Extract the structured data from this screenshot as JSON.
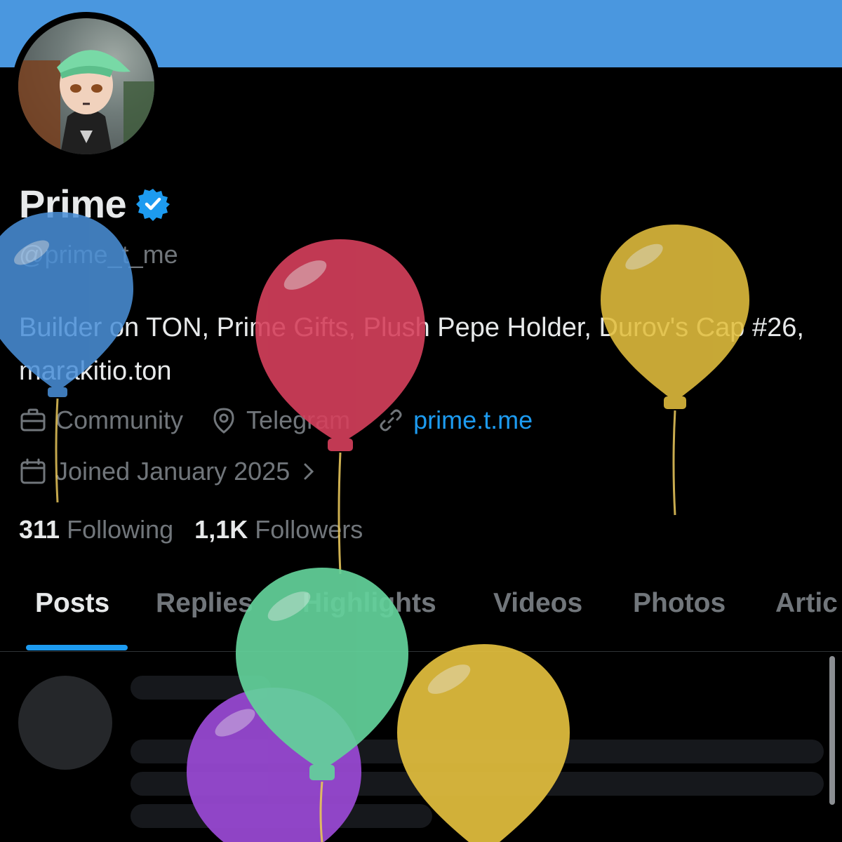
{
  "profile": {
    "display_name": "Prime",
    "handle": "@prime_t_me",
    "bio": "Builder on TON, Prime Gifts, Plush Pepe Holder, Durov's Cap #26, marakitio.ton",
    "category": "Community",
    "location": "Telegram",
    "website": "prime.t.me",
    "joined": "Joined January 2025",
    "verified": true
  },
  "stats": {
    "following_count": "311",
    "following_label": "Following",
    "followers_count": "1,1K",
    "followers_label": "Followers"
  },
  "tabs": [
    {
      "label": "Posts",
      "active": true
    },
    {
      "label": "Replies",
      "active": false
    },
    {
      "label": "Highlights",
      "active": false
    },
    {
      "label": "Videos",
      "active": false
    },
    {
      "label": "Photos",
      "active": false
    },
    {
      "label": "Artic",
      "active": false
    }
  ],
  "icons": {
    "verified": "verified-badge-icon",
    "category": "briefcase-icon",
    "location": "location-pin-icon",
    "website": "link-icon",
    "joined": "calendar-icon",
    "joined_more": "chevron-right-icon"
  },
  "colors": {
    "banner": "#4a97df",
    "accent": "#1d9bf0",
    "balloons": [
      "#4a90d9",
      "#d6405c",
      "#e3bf3e",
      "#63d29b",
      "#9b4ad6",
      "#e3bf3e"
    ]
  }
}
